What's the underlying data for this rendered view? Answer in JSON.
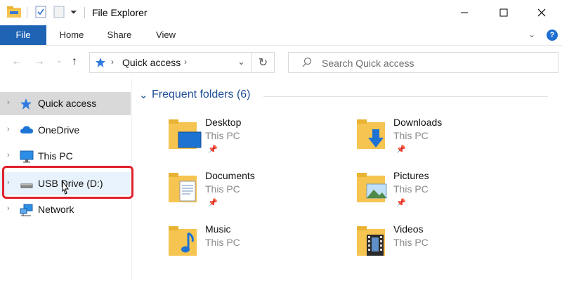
{
  "window": {
    "title": "File Explorer",
    "controls": [
      "minimize",
      "maximize",
      "close"
    ]
  },
  "ribbon": {
    "tabs": [
      "File",
      "Home",
      "Share",
      "View"
    ]
  },
  "address": {
    "path": [
      "Quick access"
    ],
    "search_placeholder": "Search Quick access"
  },
  "nav_pane": {
    "items": [
      {
        "label": "Quick access",
        "icon": "star-icon",
        "state": "selected"
      },
      {
        "label": "OneDrive",
        "icon": "cloud-icon"
      },
      {
        "label": "This PC",
        "icon": "monitor-icon"
      },
      {
        "label": "USB Drive (D:)",
        "icon": "usb-drive-icon",
        "state": "hover",
        "highlighted": true
      },
      {
        "label": "Network",
        "icon": "network-icon"
      }
    ]
  },
  "content": {
    "group_title": "Frequent folders (6)",
    "folders": [
      {
        "name": "Desktop",
        "location": "This PC",
        "icon": "desktop-folder-icon",
        "pinned": true
      },
      {
        "name": "Downloads",
        "location": "This PC",
        "icon": "downloads-folder-icon",
        "pinned": true
      },
      {
        "name": "Documents",
        "location": "This PC",
        "icon": "documents-folder-icon",
        "pinned": true
      },
      {
        "name": "Pictures",
        "location": "This PC",
        "icon": "pictures-folder-icon",
        "pinned": true
      },
      {
        "name": "Music",
        "location": "This PC",
        "icon": "music-folder-icon",
        "pinned": false
      },
      {
        "name": "Videos",
        "location": "This PC",
        "icon": "videos-folder-icon",
        "pinned": false
      }
    ]
  },
  "colors": {
    "accent": "#1f63b5",
    "folder": "#f5c451",
    "highlight_border": "#e0202b",
    "group_header": "#1e4e96"
  }
}
